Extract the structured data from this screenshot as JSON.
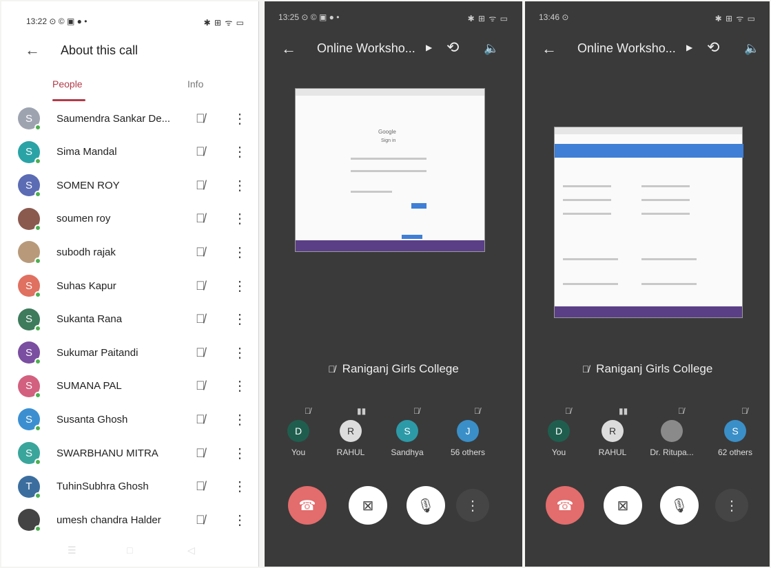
{
  "panel1": {
    "status_time": "13:22",
    "status_icons_left": "⊙ © ▣ ● •",
    "status_icons_right": "✱ ⊞ ᯤ ▭",
    "title": "About this call",
    "tab_people": "People",
    "tab_info": "Info",
    "people": [
      {
        "initial": "S",
        "name": "Saumendra Sankar De...",
        "color": "#9ea3b0"
      },
      {
        "initial": "S",
        "name": "Sima Mandal",
        "color": "#2aa3a6"
      },
      {
        "initial": "S",
        "name": "SOMEN ROY",
        "color": "#5b6bb4"
      },
      {
        "initial": "",
        "name": "soumen roy",
        "color": "#8a5a4f"
      },
      {
        "initial": "",
        "name": "subodh rajak",
        "color": "#b89a7a"
      },
      {
        "initial": "S",
        "name": "Suhas Kapur",
        "color": "#e07060"
      },
      {
        "initial": "S",
        "name": "Sukanta Rana",
        "color": "#3e7a5c"
      },
      {
        "initial": "S",
        "name": "Sukumar Paitandi",
        "color": "#7a4ea0"
      },
      {
        "initial": "S",
        "name": "SUMANA PAL",
        "color": "#d2607e"
      },
      {
        "initial": "S",
        "name": "Susanta Ghosh",
        "color": "#3b8fd1"
      },
      {
        "initial": "S",
        "name": "SWARBHANU MITRA",
        "color": "#3aa59b"
      },
      {
        "initial": "T",
        "name": "TuhinSubhra Ghosh",
        "color": "#3b6e9e"
      },
      {
        "initial": "",
        "name": "umesh chandra Halder",
        "color": "#444444"
      }
    ]
  },
  "panel2": {
    "status_time": "13:25",
    "status_icons_left": "⊙ © ▣ ● •",
    "status_icons_right": "✱ ⊞ ᯤ ▭",
    "title": "Online Worksho...",
    "presenter": "Raniganj Girls College",
    "participants": [
      {
        "initial": "D",
        "label": "You",
        "color": "#1f5e4e"
      },
      {
        "initial": "R",
        "label": "RAHUL",
        "color": "#dcdcdc"
      },
      {
        "initial": "S",
        "label": "Sandhya",
        "color": "#2d9aa8"
      },
      {
        "initial": "J",
        "label": "56 others",
        "color": "#3a8fc8"
      }
    ]
  },
  "panel3": {
    "status_time": "13:46",
    "status_icons_left": "⊙",
    "status_icons_right": "✱ ⊞ ᯤ ▭",
    "title": "Online Worksho...",
    "presenter": "Raniganj Girls College",
    "participants": [
      {
        "initial": "D",
        "label": "You",
        "color": "#1f5e4e"
      },
      {
        "initial": "R",
        "label": "RAHUL",
        "color": "#dcdcdc"
      },
      {
        "initial": "",
        "label": "Dr. Ritupa...",
        "color": "#8a8a8a"
      },
      {
        "initial": "S",
        "label": "62 others",
        "color": "#3a8fc8"
      }
    ]
  }
}
